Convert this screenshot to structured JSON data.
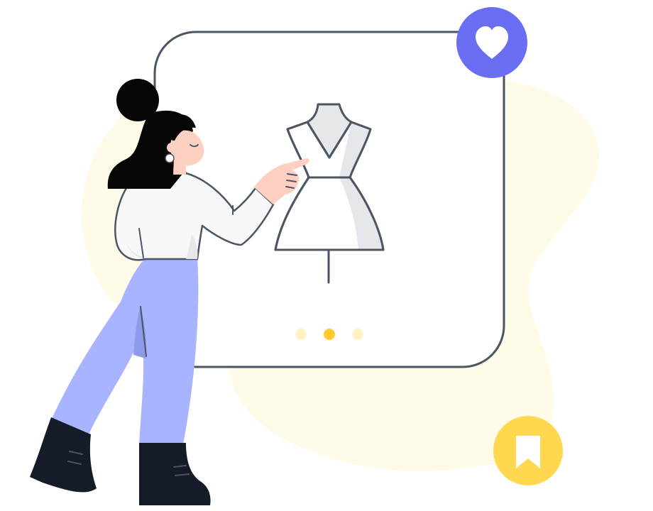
{
  "illustration": {
    "subject": "woman-browsing-dress-on-mannequin",
    "carousel": {
      "dot_count": 3,
      "active_index": 1
    },
    "icons": {
      "favorite": "heart-icon",
      "save": "bookmark-icon"
    }
  },
  "colors": {
    "background": "#ffffff",
    "blob": "#FEFBE9",
    "outline": "#4B5563",
    "favorite_badge": "#6A6EF3",
    "save_badge": "#FFD84F",
    "dot_active": "#FFC92F",
    "dot_inactive": "#FFF1C2",
    "pants": "#A8B4FF",
    "boots": "#151B28",
    "hair": "#050505",
    "skin": "#FDD0C2",
    "shirt": "#F8F8F8",
    "dress_shade": "#E6E7EB"
  }
}
